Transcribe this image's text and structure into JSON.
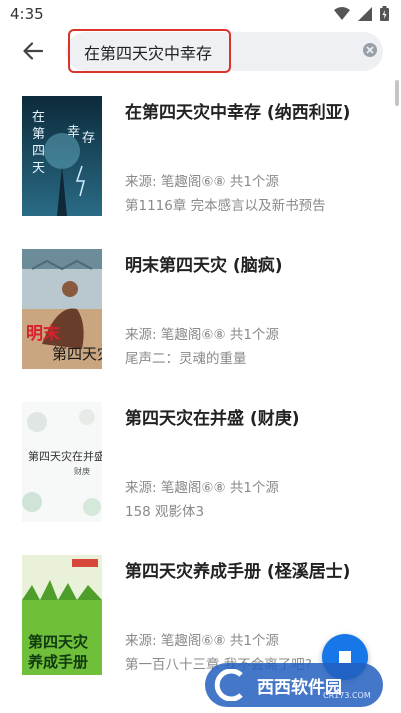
{
  "status_bar": {
    "time": "4:35"
  },
  "search": {
    "query": "在第四天灾中幸存"
  },
  "books": [
    {
      "title": "在第四天灾中幸存 (纳西利亚)",
      "source": "来源: 笔趣阁⑥⑧ 共1个源",
      "latest": "第1116章 完本感言以及新书预告",
      "cover_text": "在第四天灾中幸存"
    },
    {
      "title": "明末第四天灾 (脑疯)",
      "source": "来源: 笔趣阁⑥⑧ 共1个源",
      "latest": "尾声二：灵魂的重量",
      "cover_text": "明末第四天灾"
    },
    {
      "title": "第四天灾在并盛 (财庚)",
      "source": "来源: 笔趣阁⑥⑧ 共1个源",
      "latest": "158 观影体3",
      "cover_text": "第四天灾在并盛",
      "cover_author": "财庚"
    },
    {
      "title": "第四天灾养成手册 (柽溪居士)",
      "source": "来源: 笔趣阁⑥⑧ 共1个源",
      "latest": "第一百八十三章 我不会离了吧?",
      "cover_text": "第四天灾养成手册"
    }
  ],
  "watermark": {
    "text": "西西软件园",
    "sub": "CR173.COM"
  }
}
